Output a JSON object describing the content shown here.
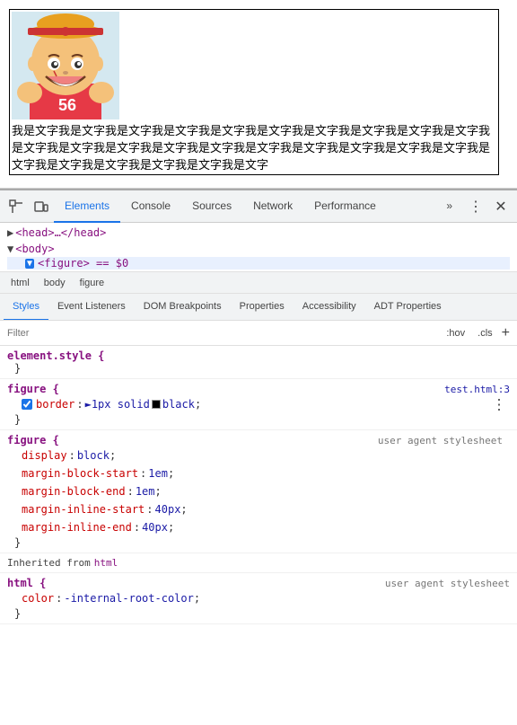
{
  "viewport": {
    "caption_text": "我是文字我是文字我是文字我是文字我是文字我是文字我是文字我是文字我是文字我是文字我是文字我是文字我是文字我是文字我是文字我是文字我是文字我是文字我是文字我是文字我是文字我是文字我是文字我是文字我是文字我是文字"
  },
  "devtools": {
    "tabs": [
      {
        "label": "Elements",
        "active": true
      },
      {
        "label": "Console",
        "active": false
      },
      {
        "label": "Sources",
        "active": false
      },
      {
        "label": "Network",
        "active": false
      },
      {
        "label": "Performance",
        "active": false
      }
    ],
    "more_tabs_label": "»",
    "kebab_menu_label": "⋮",
    "close_label": "✕"
  },
  "dom": {
    "head_tag": "<head>…</head>",
    "body_tag": "<body>",
    "figure_selected": "<figure> == $0",
    "breadcrumb_items": [
      "html",
      "body",
      "figure"
    ]
  },
  "styles_tabs": [
    {
      "label": "Styles",
      "active": true
    },
    {
      "label": "Event Listeners",
      "active": false
    },
    {
      "label": "DOM Breakpoints",
      "active": false
    },
    {
      "label": "Properties",
      "active": false
    },
    {
      "label": "Accessibility",
      "active": false
    },
    {
      "label": "ADT Properties",
      "active": false
    }
  ],
  "filter": {
    "placeholder": "Filter",
    "hov_label": ":hov",
    "cls_label": ".cls"
  },
  "css_rules": [
    {
      "id": "element_style",
      "selector": "element.style {",
      "closing": "}",
      "properties": [],
      "source": null
    },
    {
      "id": "figure_rule",
      "selector": "figure {",
      "closing": "}",
      "properties": [
        {
          "checked": true,
          "name": "border",
          "value": "► 1px solid",
          "color_swatch": "black",
          "color_name": "black",
          "semicolon": ";"
        }
      ],
      "source": "test.html:3"
    },
    {
      "id": "figure_ua",
      "selector": "figure {",
      "closing": "}",
      "ua_label": "user agent stylesheet",
      "properties": [
        {
          "name": "display",
          "value": "block",
          "semicolon": ";"
        },
        {
          "name": "margin-block-start",
          "value": "1em",
          "semicolon": ";"
        },
        {
          "name": "margin-block-end",
          "value": "1em",
          "semicolon": ";"
        },
        {
          "name": "margin-inline-start",
          "value": "40px",
          "semicolon": ";"
        },
        {
          "name": "margin-inline-end",
          "value": "40px",
          "semicolon": ";"
        }
      ]
    }
  ],
  "inherited": {
    "label": "Inherited from",
    "tag": "html",
    "rule": {
      "selector": "html {",
      "closing": "}",
      "ua_label": "user agent stylesheet",
      "properties": [
        {
          "name": "color",
          "value": "-internal-root-color",
          "semicolon": ";"
        }
      ]
    }
  }
}
